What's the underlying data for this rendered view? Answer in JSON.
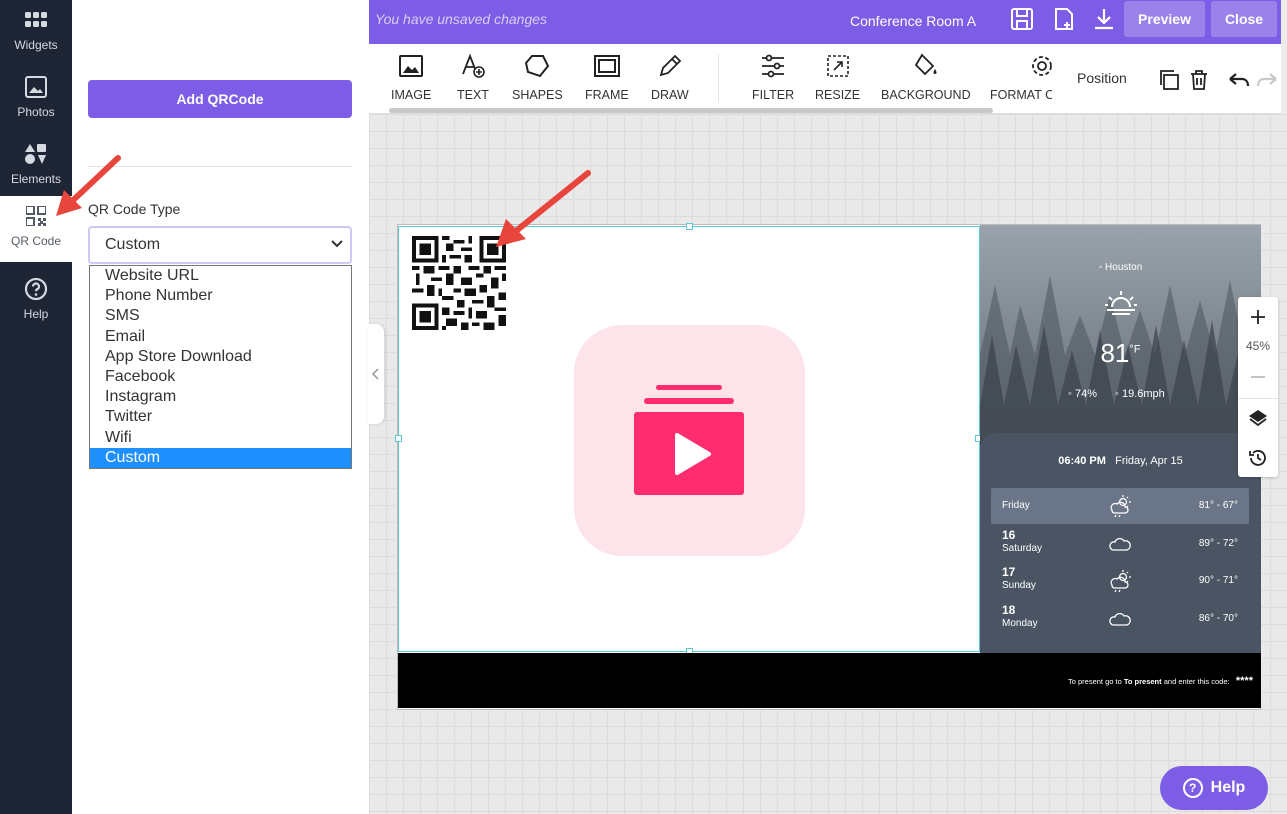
{
  "rail": {
    "items": [
      {
        "label": "Widgets",
        "icon": "widgets-icon"
      },
      {
        "label": "Photos",
        "icon": "photos-icon"
      },
      {
        "label": "Elements",
        "icon": "elements-icon"
      },
      {
        "label": "QR Code",
        "icon": "qr-code-icon",
        "active": true
      },
      {
        "label": "Help",
        "icon": "help-circle-icon"
      }
    ]
  },
  "panel": {
    "add_button": "Add QRCode",
    "qr_type_label": "QR Code Type",
    "qr_type_value": "Custom",
    "qr_type_options": [
      "Website URL",
      "Phone Number",
      "SMS",
      "Email",
      "App Store Download",
      "Facebook",
      "Instagram",
      "Twitter",
      "Wifi",
      "Custom"
    ]
  },
  "topbar": {
    "status": "You have unsaved changes",
    "room": "Conference Room A",
    "preview": "Preview",
    "close": "Close"
  },
  "toolbar": {
    "tools": [
      "IMAGE",
      "TEXT",
      "SHAPES",
      "FRAME",
      "DRAW",
      "FILTER",
      "RESIZE",
      "BACKGROUND",
      "FORMAT C"
    ],
    "position": "Position"
  },
  "weather": {
    "city": "Houston",
    "temp": "81",
    "temp_unit": "°F",
    "humidity": "74%",
    "wind": "19.6mph",
    "time": "06:40 PM",
    "date": "Friday, Apr 15",
    "days": [
      {
        "num": "",
        "name": "Friday",
        "range": "81° - 67°",
        "icon": "sun-rain-icon"
      },
      {
        "num": "16",
        "name": "Saturday",
        "range": "89° - 72°",
        "icon": "cloud-icon"
      },
      {
        "num": "17",
        "name": "Sunday",
        "range": "90° - 71°",
        "icon": "sun-rain-icon"
      },
      {
        "num": "18",
        "name": "Monday",
        "range": "86° - 70°",
        "icon": "cloud-icon"
      }
    ]
  },
  "footer": {
    "text_pre": "To present go to ",
    "text_bold": "To present",
    "text_post": " and enter this code:",
    "code": "****"
  },
  "zoom": {
    "level": "45%"
  },
  "help_button": "Help",
  "colors": {
    "accent": "#7d5ce6",
    "select_blue": "#1e90ff",
    "video_pink": "#ff2d6f",
    "video_tile": "#fde3ea",
    "arrow_red": "#e8453c"
  }
}
